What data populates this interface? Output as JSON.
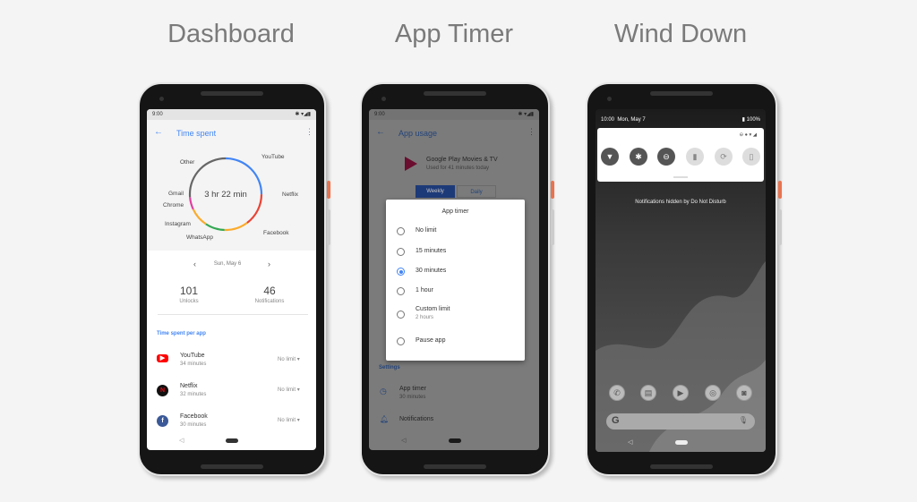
{
  "titles": [
    "Dashboard",
    "App Timer",
    "Wind Down"
  ],
  "dashboard": {
    "status_time": "9:00",
    "title": "Time spent",
    "total": "3 hr 22 min",
    "chart_labels": {
      "other": "Other",
      "youtube": "YouTube",
      "netflix": "Netflix",
      "facebook": "Facebook",
      "whatsapp": "WhatsApp",
      "instagram": "Instagram",
      "chrome": "Chrome",
      "gmail": "Gmail"
    },
    "date": "Sun, May 6",
    "unlocks": {
      "value": "101",
      "label": "Unlocks"
    },
    "notifications": {
      "value": "46",
      "label": "Notifications"
    },
    "section": "Time spent per app",
    "apps": [
      {
        "name": "YouTube",
        "time": "34 minutes",
        "limit": "No limit",
        "icon": "youtube-icon",
        "color": "#ff0000"
      },
      {
        "name": "Netflix",
        "time": "32 minutes",
        "limit": "No limit",
        "icon": "netflix-icon",
        "color": "#e50914"
      },
      {
        "name": "Facebook",
        "time": "30 minutes",
        "limit": "No limit",
        "icon": "facebook-icon",
        "color": "#3b5998"
      }
    ],
    "accent": "#4285f4"
  },
  "app_timer": {
    "status_time": "9:00",
    "title": "App usage",
    "app_name": "Google Play Movies & TV",
    "app_usage": "Used for 41 minutes today",
    "tabs": [
      "Weekly",
      "Daily"
    ],
    "settings_label": "Settings",
    "settings": [
      {
        "label": "App timer",
        "sub": "30 minutes"
      },
      {
        "label": "Notifications"
      }
    ],
    "dialog": {
      "title": "App timer",
      "options": [
        {
          "label": "No limit",
          "selected": false
        },
        {
          "label": "15 minutes",
          "selected": false
        },
        {
          "label": "30 minutes",
          "selected": true
        },
        {
          "label": "1 hour",
          "selected": false
        },
        {
          "label": "Custom limit",
          "sub": "2 hours",
          "selected": false
        },
        {
          "label": "Pause app",
          "selected": false
        }
      ]
    }
  },
  "wind_down": {
    "status_time": "10:00",
    "status_date": "Mon, May 7",
    "battery": "100%",
    "quick_tiles": [
      {
        "icon": "wifi-icon",
        "active": true
      },
      {
        "icon": "bluetooth-icon",
        "active": true
      },
      {
        "icon": "do-not-disturb-icon",
        "active": true
      },
      {
        "icon": "flashlight-icon",
        "active": false
      },
      {
        "icon": "auto-rotate-icon",
        "active": false
      },
      {
        "icon": "battery-saver-icon",
        "active": false
      }
    ],
    "message": "Notifications hidden by Do Not Disturb",
    "search_logo": "G"
  }
}
